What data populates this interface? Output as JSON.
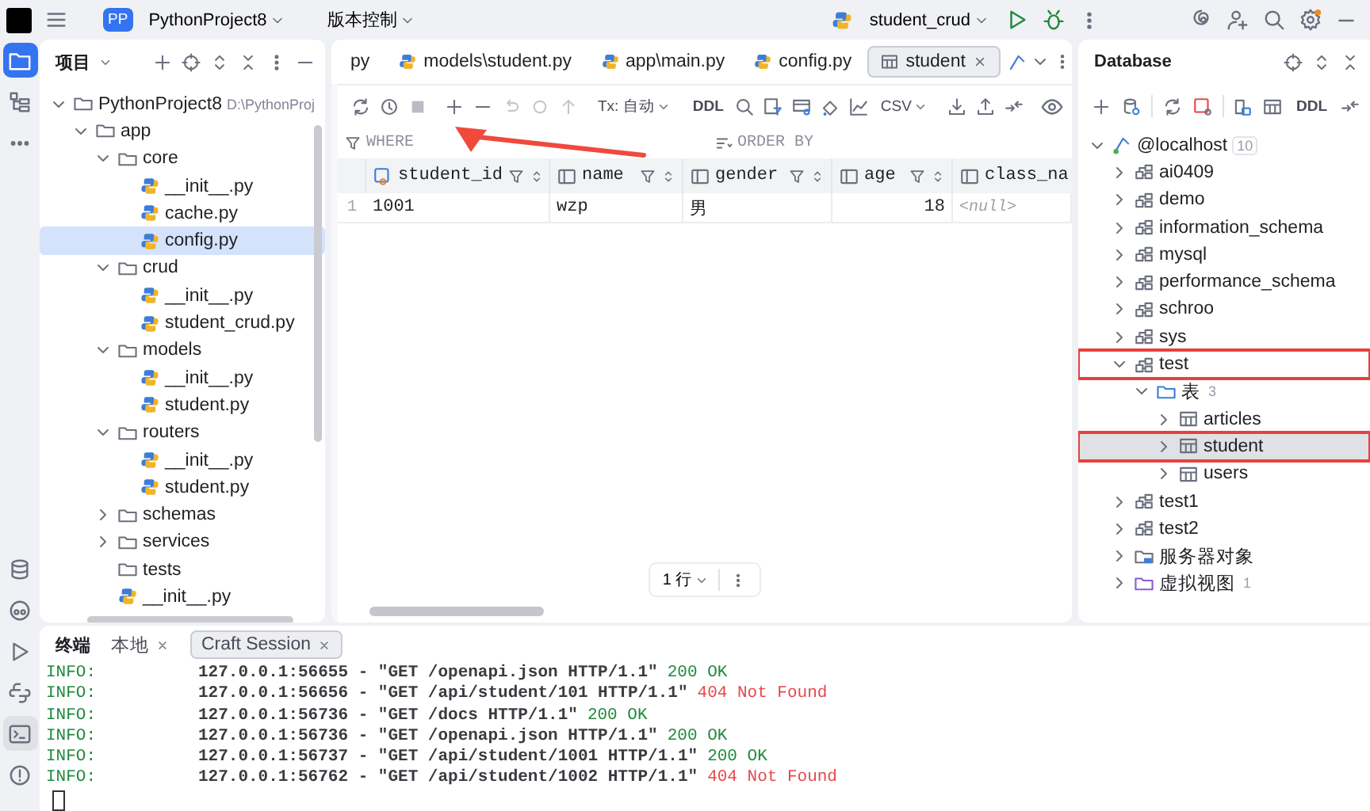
{
  "topbar": {
    "project_badge": "PP",
    "project": "PythonProject8",
    "vcs": "版本控制",
    "run_config": "student_crud"
  },
  "activity_bar": {
    "top": [
      {
        "kind": "project",
        "selected": true
      },
      {
        "kind": "structure",
        "selected": false
      },
      {
        "kind": "more",
        "selected": false
      }
    ],
    "bottom": [
      {
        "kind": "database",
        "selected": false
      },
      {
        "kind": "assistant",
        "selected": false
      },
      {
        "kind": "run",
        "selected": false
      },
      {
        "kind": "python",
        "selected": false
      },
      {
        "kind": "terminal",
        "selected": true
      },
      {
        "kind": "problems",
        "selected": false
      }
    ]
  },
  "project": {
    "title": "项目",
    "tree": [
      {
        "label": "PythonProject8",
        "path": "D:\\PythonProj",
        "kind": "root",
        "expanded": true,
        "selected": false,
        "children": [
          {
            "label": "app",
            "kind": "folder",
            "expanded": true,
            "selected": false,
            "children": [
              {
                "label": "core",
                "kind": "folder",
                "expanded": true,
                "selected": false,
                "children": [
                  {
                    "label": "__init__.py",
                    "kind": "file",
                    "selected": false
                  },
                  {
                    "label": "cache.py",
                    "kind": "file",
                    "selected": false
                  },
                  {
                    "label": "config.py",
                    "kind": "file",
                    "selected": true
                  }
                ]
              },
              {
                "label": "crud",
                "kind": "folder",
                "expanded": true,
                "selected": false,
                "children": [
                  {
                    "label": "__init__.py",
                    "kind": "file",
                    "selected": false
                  },
                  {
                    "label": "student_crud.py",
                    "kind": "file",
                    "selected": false
                  }
                ]
              },
              {
                "label": "models",
                "kind": "folder",
                "expanded": true,
                "selected": false,
                "children": [
                  {
                    "label": "__init__.py",
                    "kind": "file",
                    "selected": false
                  },
                  {
                    "label": "student.py",
                    "kind": "file",
                    "selected": false
                  }
                ]
              },
              {
                "label": "routers",
                "kind": "folder",
                "expanded": true,
                "selected": false,
                "children": [
                  {
                    "label": "__init__.py",
                    "kind": "file",
                    "selected": false
                  },
                  {
                    "label": "student.py",
                    "kind": "file",
                    "selected": false
                  }
                ]
              },
              {
                "label": "schemas",
                "kind": "folder",
                "expanded": false,
                "selected": false
              },
              {
                "label": "services",
                "kind": "folder",
                "expanded": false,
                "selected": false
              },
              {
                "label": "tests",
                "kind": "folder",
                "selected": false
              },
              {
                "label": "__init__.py",
                "kind": "file",
                "selected": false
              }
            ]
          }
        ]
      }
    ]
  },
  "editor": {
    "tabs": [
      {
        "label": "py",
        "kind": "python",
        "selected": false
      },
      {
        "label": "models\\student.py",
        "kind": "python",
        "selected": false
      },
      {
        "label": "app\\main.py",
        "kind": "python",
        "selected": false
      },
      {
        "label": "config.py",
        "kind": "python",
        "selected": false
      },
      {
        "label": "student",
        "kind": "table",
        "selected": true
      }
    ],
    "toolbar": {
      "transaction": "Tx: 自动",
      "ddl": "DDL",
      "export": "CSV"
    },
    "where": "WHERE",
    "order_by": "ORDER BY",
    "columns": [
      {
        "name": "student_id",
        "kind": "key"
      },
      {
        "name": "name",
        "kind": "column"
      },
      {
        "name": "gender",
        "kind": "column"
      },
      {
        "name": "age",
        "kind": "column"
      },
      {
        "name": "class_na",
        "kind": "column"
      }
    ],
    "rows": [
      {
        "number": "1",
        "cells": [
          {
            "text": "1001",
            "kind": "text"
          },
          {
            "text": "wzp",
            "kind": "text"
          },
          {
            "text": "男",
            "kind": "text"
          },
          {
            "text": "18",
            "kind": "number"
          },
          {
            "text": "<null>",
            "kind": "null"
          }
        ]
      }
    ],
    "pager": "1 行",
    "annotation_arrow": true
  },
  "database": {
    "title": "Database",
    "ddl": "DDL",
    "tree": [
      {
        "label": "@localhost",
        "count": "10",
        "kind": "host",
        "expanded": true,
        "selected": false,
        "children": [
          {
            "label": "ai0409",
            "kind": "schema",
            "expanded": false,
            "selected": false
          },
          {
            "label": "demo",
            "kind": "schema",
            "expanded": false,
            "selected": false
          },
          {
            "label": "information_schema",
            "kind": "schema",
            "expanded": false,
            "selected": false
          },
          {
            "label": "mysql",
            "kind": "schema",
            "expanded": false,
            "selected": false
          },
          {
            "label": "performance_schema",
            "kind": "schema",
            "expanded": false,
            "selected": false
          },
          {
            "label": "schroo",
            "kind": "schema",
            "expanded": false,
            "selected": false
          },
          {
            "label": "sys",
            "kind": "schema",
            "expanded": false,
            "selected": false
          },
          {
            "label": "test",
            "kind": "schema",
            "expanded": true,
            "selected": false,
            "boxed": true,
            "children": [
              {
                "label": "表",
                "count": "3",
                "kind": "tables",
                "expanded": true,
                "selected": false,
                "children": [
                  {
                    "label": "articles",
                    "kind": "table",
                    "expanded": false,
                    "selected": false
                  },
                  {
                    "label": "student",
                    "kind": "table",
                    "expanded": false,
                    "selected": true,
                    "boxed": true
                  },
                  {
                    "label": "users",
                    "kind": "table",
                    "expanded": false,
                    "selected": false
                  }
                ]
              }
            ]
          },
          {
            "label": "test1",
            "kind": "schema",
            "expanded": false,
            "selected": false
          },
          {
            "label": "test2",
            "kind": "schema",
            "expanded": false,
            "selected": false
          },
          {
            "label": "服务器对象",
            "kind": "server",
            "expanded": false,
            "selected": false
          },
          {
            "label": "虚拟视图",
            "count": "1",
            "kind": "views",
            "expanded": false,
            "selected": false
          }
        ]
      }
    ]
  },
  "terminal": {
    "title": "终端",
    "tabs": [
      {
        "label": "本地",
        "selected": false
      },
      {
        "label": "Craft Session",
        "selected": true
      }
    ],
    "lines": [
      {
        "level": "INFO:",
        "message": "127.0.0.1:56655 - \"GET /openapi.json HTTP/1.1\"",
        "status": "200 OK",
        "kind": "ok"
      },
      {
        "level": "INFO:",
        "message": "127.0.0.1:56656 - \"GET /api/student/101 HTTP/1.1\"",
        "status": "404 Not Found",
        "kind": "error"
      },
      {
        "level": "INFO:",
        "message": "127.0.0.1:56736 - \"GET /docs HTTP/1.1\"",
        "status": "200 OK",
        "kind": "ok"
      },
      {
        "level": "INFO:",
        "message": "127.0.0.1:56736 - \"GET /openapi.json HTTP/1.1\"",
        "status": "200 OK",
        "kind": "ok"
      },
      {
        "level": "INFO:",
        "message": "127.0.0.1:56737 - \"GET /api/student/1001 HTTP/1.1\"",
        "status": "200 OK",
        "kind": "ok"
      },
      {
        "level": "INFO:",
        "message": "127.0.0.1:56762 - \"GET /api/student/1002 HTTP/1.1\"",
        "status": "404 Not Found",
        "kind": "error"
      }
    ]
  }
}
